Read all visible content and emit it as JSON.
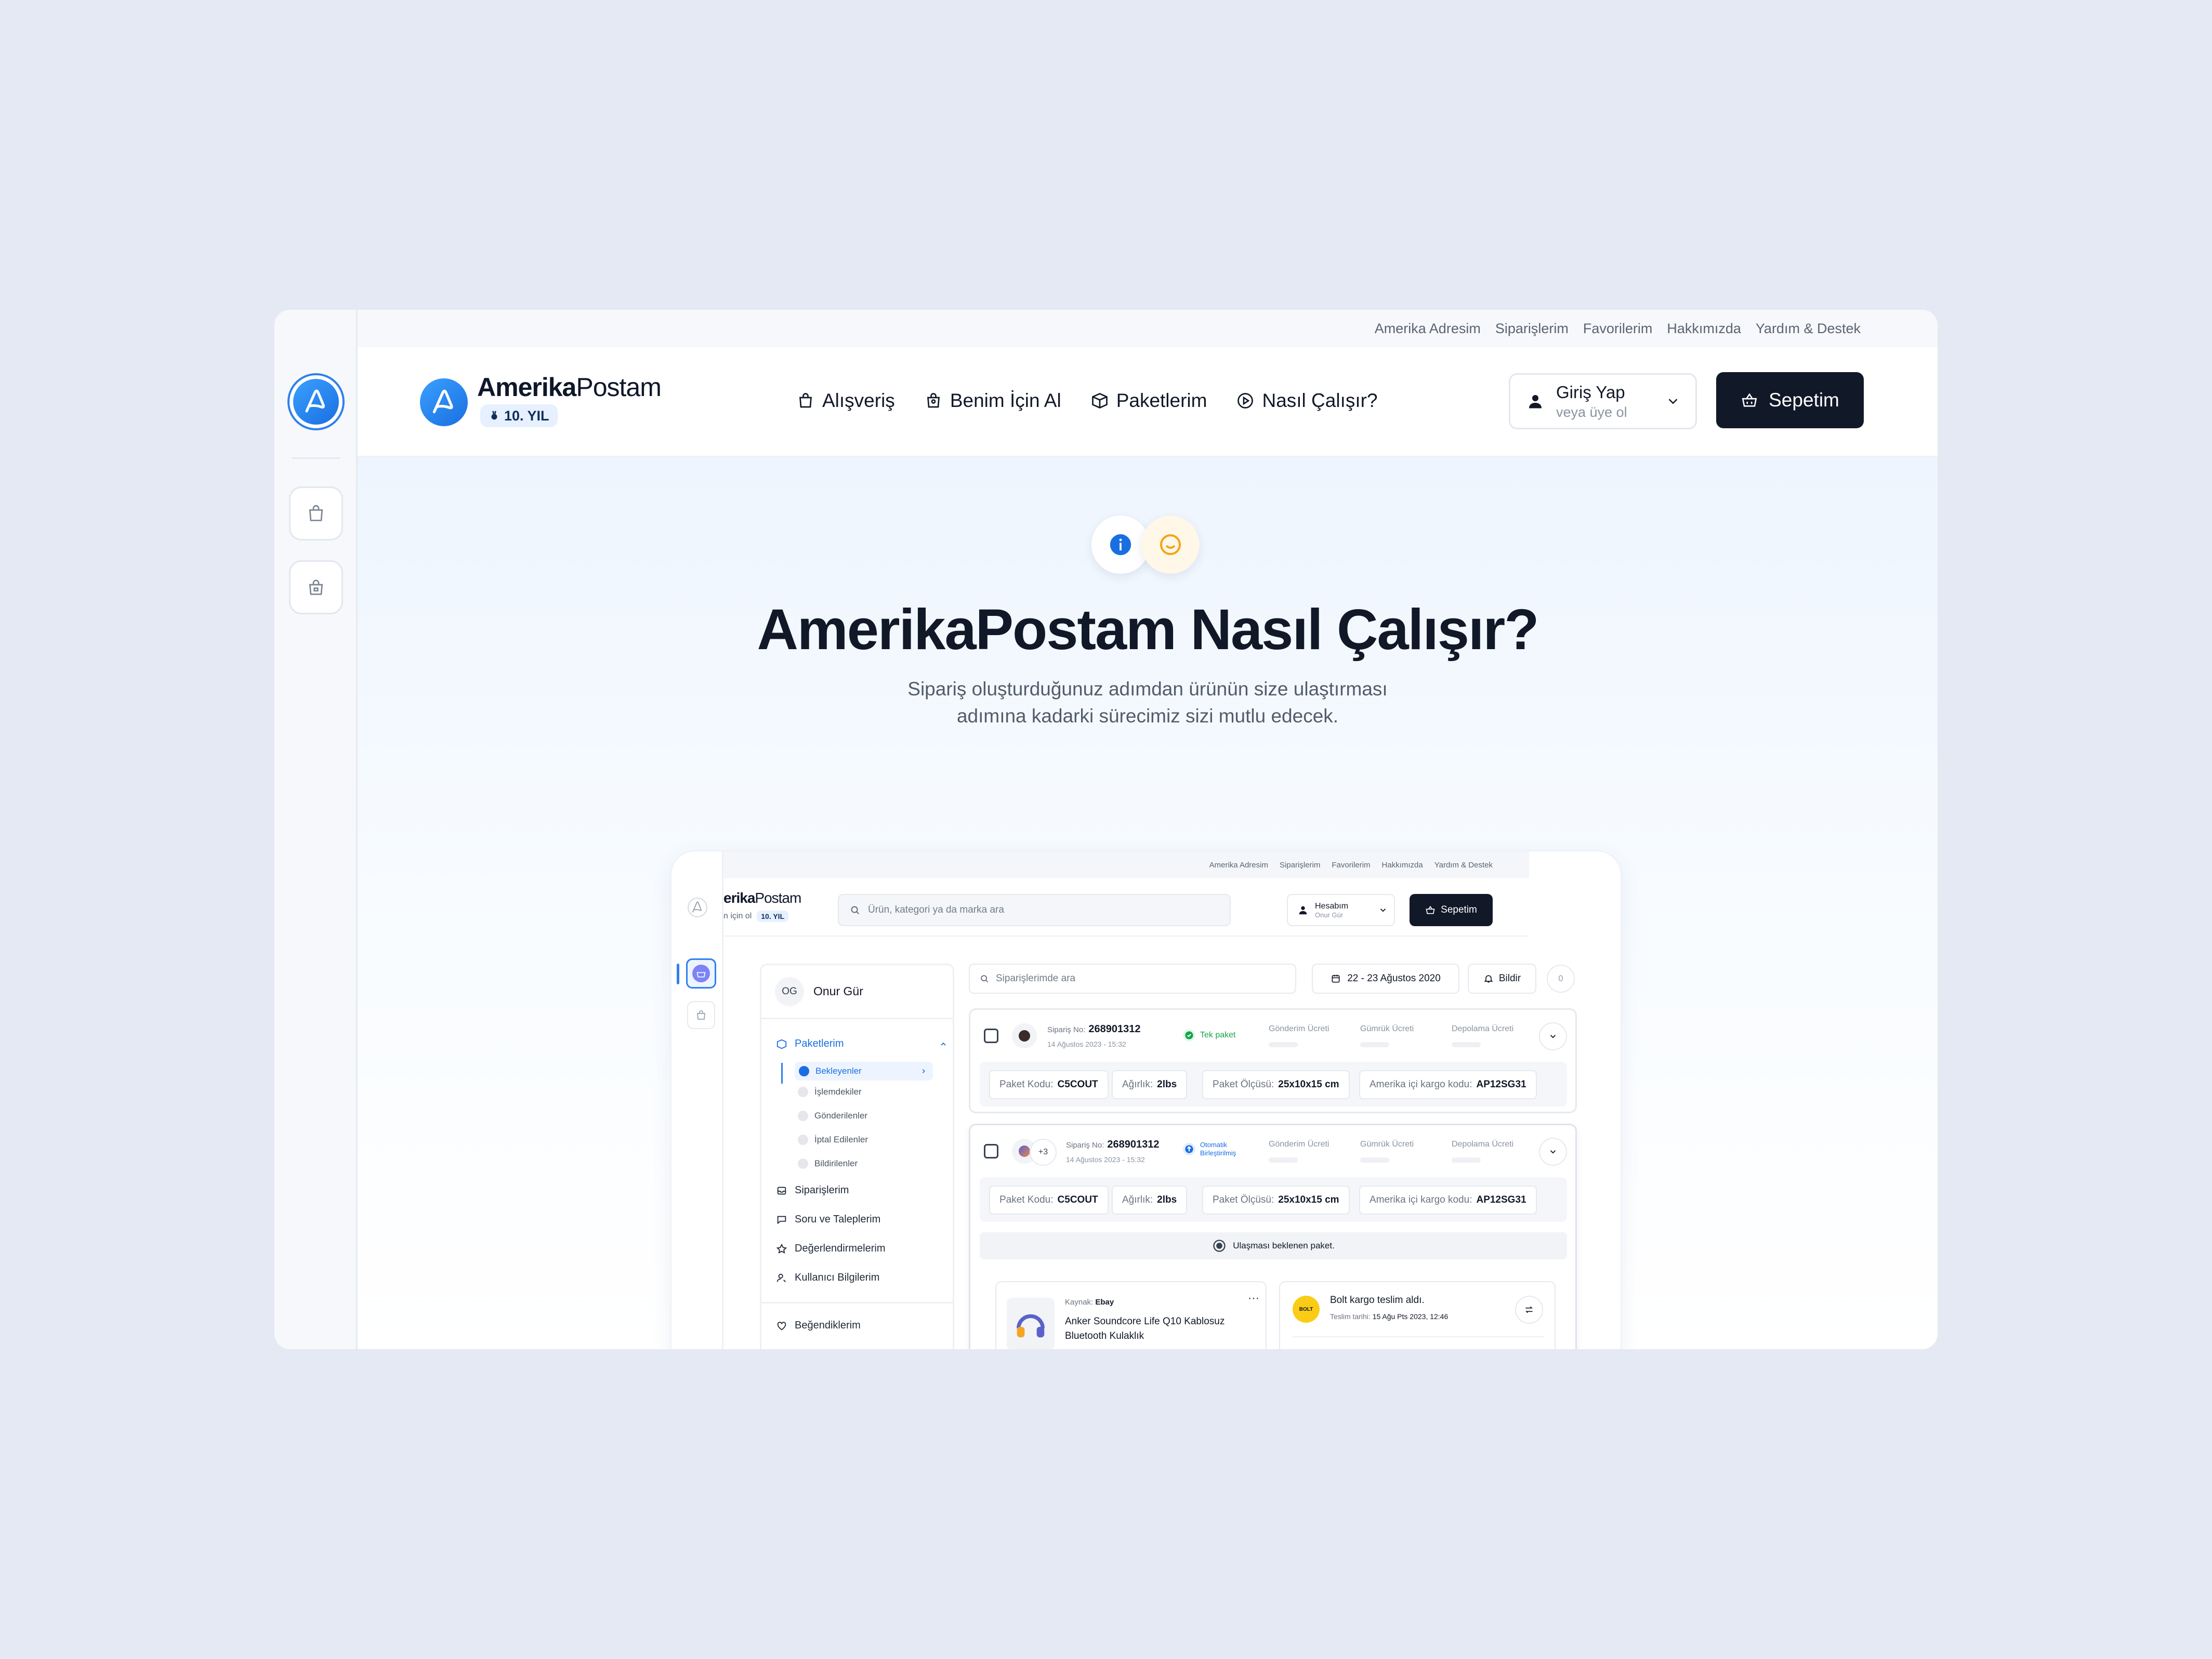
{
  "topbar": {
    "links": [
      "Amerika Adresim",
      "Siparişlerim",
      "Favorilerim",
      "Hakkımızda",
      "Yardım & Destek"
    ]
  },
  "header": {
    "brand_bold": "Amerika",
    "brand_light": "Postam",
    "badge": "10. YIL",
    "nav": [
      {
        "label": "Alışveriş",
        "icon": "shopping-bag-icon"
      },
      {
        "label": "Benim İçin Al",
        "icon": "bag-user-icon"
      },
      {
        "label": "Paketlerim",
        "icon": "package-icon"
      },
      {
        "label": "Nasıl Çalışır?",
        "icon": "play-circle-icon"
      }
    ],
    "login_title": "Giriş Yap",
    "login_sub": "veya üye ol",
    "cart_label": "Sepetim"
  },
  "hero": {
    "title": "AmerikaPostam Nasıl Çalışır?",
    "subtitle": "Sipariş oluşturduğunuz adımdan ürünün size ulaştırması adımına kadarki sürecimiz sizi mutlu edecek."
  },
  "mock": {
    "topbar": [
      "Amerika Adresim",
      "Siparişlerim",
      "Favorilerim",
      "Hakkımızda",
      "Yardım & Destek"
    ],
    "brand_bold": "erika",
    "brand_light": "Postam",
    "brand_sub": "n için ol",
    "badge": "10. YIL",
    "search_placeholder": "Ürün, kategori ya da marka ara",
    "account_title": "Hesabım",
    "account_sub": "Onur Gür",
    "cart_label": "Sepetim",
    "user_initials": "OG",
    "user_name": "Onur Gür",
    "menu": {
      "packages": "Paketlerim",
      "sub": [
        "Bekleyenler",
        "İşlemdekiler",
        "Gönderilenler",
        "İptal Edilenler",
        "Bildirilenler"
      ],
      "orders": "Siparişlerim",
      "tickets": "Soru ve Taleplerim",
      "reviews": "Değerlendirmelerim",
      "user_info": "Kullanıcı Bilgilerim",
      "likes": "Beğendiklerim"
    },
    "filter_placeholder": "Siparişlerimde ara",
    "date_range": "22 - 23 Ağustos 2020",
    "notify": "Bildir",
    "count": "0",
    "orders": [
      {
        "no_label": "Sipariş No:",
        "no": "268901312",
        "date": "14 Ağustos 2023 - 15:32",
        "status": "Tek paket",
        "extra": "",
        "cols": [
          "Gönderim Ücreti",
          "Gümrük Ücreti",
          "Depolama Ücreti"
        ],
        "chips": [
          {
            "label": "Paket Kodu:",
            "value": "C5COUT"
          },
          {
            "label": "Ağırlık:",
            "value": "2lbs"
          },
          {
            "label": "Paket Ölçüsü:",
            "value": "25x10x15 cm"
          },
          {
            "label": "Amerika içi kargo kodu:",
            "value": "AP12SG31"
          }
        ]
      },
      {
        "no_label": "Sipariş No:",
        "no": "268901312",
        "date": "14 Ağustos 2023 - 15:32",
        "status": "Otomatik Birleştirilmiş",
        "extra": "+3",
        "cols": [
          "Gönderim Ücreti",
          "Gümrük Ücreti",
          "Depolama Ücreti"
        ],
        "chips": [
          {
            "label": "Paket Kodu:",
            "value": "C5COUT"
          },
          {
            "label": "Ağırlık:",
            "value": "2lbs"
          },
          {
            "label": "Paket Ölçüsü:",
            "value": "25x10x15 cm"
          },
          {
            "label": "Amerika içi kargo kodu:",
            "value": "AP12SG31"
          }
        ],
        "note": "Ulaşması beklenen paket.",
        "product_source_label": "Kaynak:",
        "product_source": "Ebay",
        "product_name": "Anker Soundcore Life Q10 Kablosuz Bluetooth Kulaklık",
        "carrier_badge": "BOLT",
        "delivery_title": "Bolt kargo teslim aldı.",
        "delivery_date_label": "Teslim tarihi:",
        "delivery_date": "15 Ağu Pts 2023, 12:46"
      }
    ]
  },
  "colors": {
    "accent": "#1a6fe0",
    "dark": "#111827",
    "background": "#e4e9f3",
    "success": "#16a34a"
  }
}
